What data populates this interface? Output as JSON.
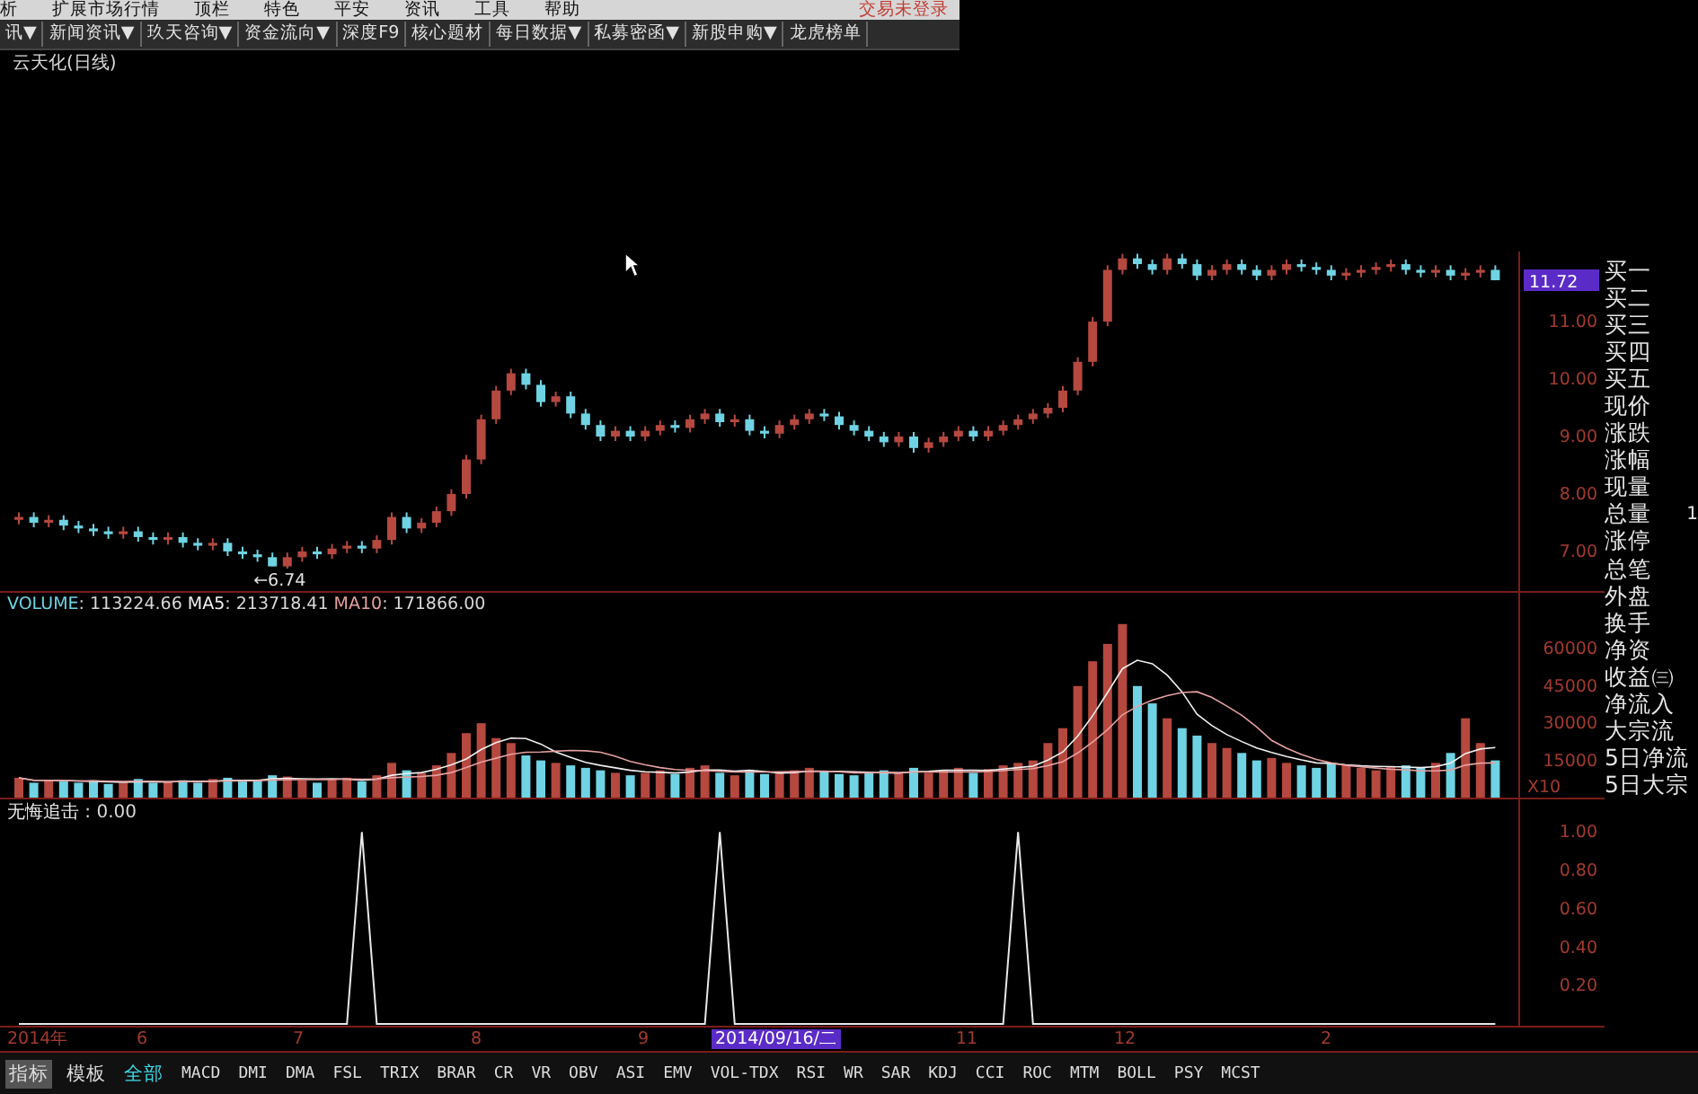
{
  "menu_bar": {
    "items": [
      "析",
      "扩展市场行情",
      "顶栏",
      "特色",
      "平安",
      "资讯",
      "工具",
      "帮助"
    ],
    "login_status": "交易未登录"
  },
  "toolbar": {
    "items": [
      "讯▼",
      "新闻资讯▼",
      "玖天咨询▼",
      "资金流向▼",
      "深度F9",
      "核心题材",
      "每日数据▼",
      "私募密函▼",
      "新股申购▼",
      "龙虎榜单"
    ]
  },
  "price_chart": {
    "title": "云天化(日线)",
    "low_marker": "←6.74",
    "current_price": "11.72",
    "chart_data": {
      "type": "candlestick",
      "ylim": [
        6.28,
        12.22
      ],
      "yticks": [
        {
          "value": 11,
          "label": "11.00"
        },
        {
          "value": 10,
          "label": "10.00"
        },
        {
          "value": 9,
          "label": "9.00"
        },
        {
          "value": 8,
          "label": "8.00"
        },
        {
          "value": 7,
          "label": "7.00"
        }
      ],
      "categories": [
        null,
        null,
        null,
        null,
        null,
        null,
        null,
        null,
        null,
        null,
        null,
        null,
        null,
        null,
        null,
        null,
        null,
        null,
        null,
        null,
        null,
        null,
        null,
        null,
        null,
        null,
        null,
        null,
        null,
        null,
        null,
        null,
        null,
        null,
        null,
        null,
        null,
        null,
        null,
        null,
        null,
        null,
        null,
        null,
        null,
        null,
        null,
        null,
        null,
        null,
        null,
        null,
        null,
        null,
        null,
        null,
        null,
        null,
        null,
        null,
        null,
        null,
        null,
        null,
        null,
        null,
        null,
        null,
        null,
        null,
        null,
        null,
        null,
        null,
        null,
        null,
        null,
        null,
        null,
        null,
        null,
        null,
        null,
        null,
        null,
        null,
        null,
        null,
        null,
        null,
        null,
        null,
        null,
        null,
        null,
        null,
        null,
        null,
        null,
        null
      ],
      "ohlc": [
        [
          7.55,
          7.68,
          7.47,
          7.6
        ],
        [
          7.6,
          7.68,
          7.42,
          7.5
        ],
        [
          7.5,
          7.63,
          7.42,
          7.55
        ],
        [
          7.55,
          7.63,
          7.37,
          7.45
        ],
        [
          7.45,
          7.53,
          7.32,
          7.4
        ],
        [
          7.4,
          7.48,
          7.27,
          7.35
        ],
        [
          7.35,
          7.43,
          7.22,
          7.3
        ],
        [
          7.3,
          7.43,
          7.22,
          7.35
        ],
        [
          7.35,
          7.43,
          7.17,
          7.25
        ],
        [
          7.25,
          7.33,
          7.12,
          7.2
        ],
        [
          7.2,
          7.33,
          7.12,
          7.25
        ],
        [
          7.25,
          7.33,
          7.07,
          7.15
        ],
        [
          7.15,
          7.23,
          7.02,
          7.1
        ],
        [
          7.1,
          7.23,
          7.02,
          7.15
        ],
        [
          7.15,
          7.23,
          6.92,
          7.0
        ],
        [
          7.0,
          7.08,
          6.87,
          6.95
        ],
        [
          6.95,
          7.03,
          6.82,
          6.9
        ],
        [
          6.9,
          6.98,
          6.74,
          6.74
        ],
        [
          6.74,
          6.98,
          6.7,
          6.9
        ],
        [
          6.9,
          7.08,
          6.82,
          7.0
        ],
        [
          7.0,
          7.08,
          6.87,
          6.95
        ],
        [
          6.95,
          7.13,
          6.87,
          7.05
        ],
        [
          7.05,
          7.18,
          6.97,
          7.1
        ],
        [
          7.1,
          7.18,
          6.97,
          7.05
        ],
        [
          7.05,
          7.28,
          6.97,
          7.2
        ],
        [
          7.2,
          7.68,
          7.12,
          7.6
        ],
        [
          7.6,
          7.68,
          7.32,
          7.4
        ],
        [
          7.4,
          7.58,
          7.32,
          7.5
        ],
        [
          7.5,
          7.78,
          7.42,
          7.7
        ],
        [
          7.7,
          8.08,
          7.62,
          8.0
        ],
        [
          8.0,
          8.68,
          7.92,
          8.6
        ],
        [
          8.6,
          9.38,
          8.52,
          9.3
        ],
        [
          9.3,
          9.88,
          9.22,
          9.8
        ],
        [
          9.8,
          10.18,
          9.72,
          10.1
        ],
        [
          10.1,
          10.18,
          9.82,
          9.9
        ],
        [
          9.9,
          9.98,
          9.52,
          9.6
        ],
        [
          9.6,
          9.78,
          9.52,
          9.7
        ],
        [
          9.7,
          9.78,
          9.32,
          9.4
        ],
        [
          9.4,
          9.48,
          9.12,
          9.2
        ],
        [
          9.2,
          9.28,
          8.92,
          9.0
        ],
        [
          9.0,
          9.18,
          8.92,
          9.1
        ],
        [
          9.1,
          9.18,
          8.92,
          9.0
        ],
        [
          9.0,
          9.18,
          8.92,
          9.1
        ],
        [
          9.1,
          9.28,
          9.02,
          9.2
        ],
        [
          9.2,
          9.28,
          9.07,
          9.15
        ],
        [
          9.15,
          9.38,
          9.07,
          9.3
        ],
        [
          9.3,
          9.48,
          9.22,
          9.4
        ],
        [
          9.4,
          9.48,
          9.17,
          9.25
        ],
        [
          9.25,
          9.38,
          9.17,
          9.3
        ],
        [
          9.3,
          9.38,
          9.02,
          9.1
        ],
        [
          9.1,
          9.18,
          8.97,
          9.05
        ],
        [
          9.05,
          9.28,
          8.97,
          9.2
        ],
        [
          9.2,
          9.38,
          9.12,
          9.3
        ],
        [
          9.3,
          9.48,
          9.22,
          9.4
        ],
        [
          9.4,
          9.48,
          9.27,
          9.35
        ],
        [
          9.35,
          9.43,
          9.12,
          9.2
        ],
        [
          9.2,
          9.28,
          9.02,
          9.1
        ],
        [
          9.1,
          9.18,
          8.92,
          9.0
        ],
        [
          9.0,
          9.08,
          8.82,
          8.9
        ],
        [
          8.9,
          9.08,
          8.82,
          9.0
        ],
        [
          9.0,
          9.08,
          8.72,
          8.8
        ],
        [
          8.8,
          8.98,
          8.72,
          8.9
        ],
        [
          8.9,
          9.08,
          8.82,
          9.0
        ],
        [
          9.0,
          9.18,
          8.92,
          9.1
        ],
        [
          9.1,
          9.18,
          8.92,
          9.0
        ],
        [
          9.0,
          9.18,
          8.92,
          9.1
        ],
        [
          9.1,
          9.28,
          9.02,
          9.2
        ],
        [
          9.2,
          9.38,
          9.12,
          9.3
        ],
        [
          9.3,
          9.48,
          9.22,
          9.4
        ],
        [
          9.4,
          9.58,
          9.32,
          9.5
        ],
        [
          9.5,
          9.88,
          9.42,
          9.8
        ],
        [
          9.8,
          10.38,
          9.72,
          10.3
        ],
        [
          10.3,
          11.08,
          10.22,
          11.0
        ],
        [
          11.0,
          11.98,
          10.92,
          11.9
        ],
        [
          11.9,
          12.18,
          11.82,
          12.1
        ],
        [
          12.1,
          12.18,
          11.92,
          12.0
        ],
        [
          12.0,
          12.08,
          11.82,
          11.9
        ],
        [
          11.9,
          12.18,
          11.82,
          12.1
        ],
        [
          12.1,
          12.18,
          11.92,
          12.0
        ],
        [
          12.0,
          12.08,
          11.72,
          11.8
        ],
        [
          11.8,
          11.98,
          11.72,
          11.9
        ],
        [
          11.9,
          12.08,
          11.82,
          12.0
        ],
        [
          12.0,
          12.08,
          11.82,
          11.9
        ],
        [
          11.9,
          11.98,
          11.72,
          11.8
        ],
        [
          11.8,
          11.98,
          11.72,
          11.9
        ],
        [
          11.9,
          12.08,
          11.82,
          12.0
        ],
        [
          12.0,
          12.08,
          11.87,
          11.95
        ],
        [
          11.95,
          12.03,
          11.82,
          11.9
        ],
        [
          11.9,
          11.98,
          11.72,
          11.8
        ],
        [
          11.8,
          11.93,
          11.72,
          11.85
        ],
        [
          11.85,
          11.98,
          11.77,
          11.9
        ],
        [
          11.9,
          12.03,
          11.82,
          11.95
        ],
        [
          11.95,
          12.08,
          11.87,
          12.0
        ],
        [
          12.0,
          12.08,
          11.82,
          11.9
        ],
        [
          11.9,
          11.98,
          11.77,
          11.85
        ],
        [
          11.85,
          11.98,
          11.77,
          11.9
        ],
        [
          11.9,
          11.98,
          11.72,
          11.8
        ],
        [
          11.8,
          11.93,
          11.72,
          11.85
        ],
        [
          11.85,
          11.98,
          11.77,
          11.9
        ],
        [
          11.9,
          11.98,
          11.72,
          11.72
        ]
      ]
    }
  },
  "volume_chart": {
    "separator": ": ",
    "readouts": [
      "113224.66",
      "213718.41",
      "171866.00"
    ],
    "unit_label": "X10",
    "chart_data": {
      "type": "bar",
      "categories": [
        null,
        null,
        null,
        null,
        null,
        null,
        null,
        null,
        null,
        null,
        null,
        null,
        null,
        null,
        null,
        null,
        null,
        null,
        null,
        null,
        null,
        null,
        null,
        null,
        null,
        null,
        null,
        null,
        null,
        null,
        null,
        null,
        null,
        null,
        null,
        null,
        null,
        null,
        null,
        null,
        null,
        null,
        null,
        null,
        null,
        null,
        null,
        null,
        null,
        null,
        null,
        null,
        null,
        null,
        null,
        null,
        null,
        null,
        null,
        null,
        null,
        null,
        null,
        null,
        null,
        null,
        null,
        null,
        null,
        null,
        null,
        null,
        null,
        null,
        null,
        null,
        null,
        null,
        null,
        null,
        null,
        null,
        null,
        null,
        null,
        null,
        null,
        null,
        null,
        null,
        null,
        null,
        null,
        null,
        null,
        null,
        null,
        null,
        null,
        null
      ],
      "ylim": [
        0,
        82600
      ],
      "yticks": [
        {
          "value": 15000,
          "label": "15000"
        },
        {
          "value": 30000,
          "label": "30000"
        },
        {
          "value": 45000,
          "label": "45000"
        },
        {
          "value": 60000,
          "label": "60000"
        }
      ],
      "series": [
        {
          "name": "VOLUME",
          "type": "bar",
          "colors": [
            "#b5483f",
            "#6fd3e3",
            "#b5483f",
            "#6fd3e3",
            "#6fd3e3",
            "#6fd3e3",
            "#6fd3e3",
            "#b5483f",
            "#6fd3e3",
            "#6fd3e3",
            "#b5483f",
            "#6fd3e3",
            "#6fd3e3",
            "#b5483f",
            "#6fd3e3",
            "#6fd3e3",
            "#6fd3e3",
            "#6fd3e3",
            "#b5483f",
            "#b5483f",
            "#6fd3e3",
            "#b5483f",
            "#b5483f",
            "#6fd3e3",
            "#b5483f",
            "#b5483f",
            "#6fd3e3",
            "#b5483f",
            "#b5483f",
            "#b5483f",
            "#b5483f",
            "#b5483f",
            "#b5483f",
            "#b5483f",
            "#6fd3e3",
            "#6fd3e3",
            "#b5483f",
            "#6fd3e3",
            "#6fd3e3",
            "#6fd3e3",
            "#b5483f",
            "#6fd3e3",
            "#b5483f",
            "#b5483f",
            "#6fd3e3",
            "#b5483f",
            "#b5483f",
            "#6fd3e3",
            "#b5483f",
            "#6fd3e3",
            "#6fd3e3",
            "#b5483f",
            "#b5483f",
            "#b5483f",
            "#6fd3e3",
            "#6fd3e3",
            "#6fd3e3",
            "#6fd3e3",
            "#6fd3e3",
            "#b5483f",
            "#6fd3e3",
            "#b5483f",
            "#b5483f",
            "#b5483f",
            "#6fd3e3",
            "#b5483f",
            "#b5483f",
            "#b5483f",
            "#b5483f",
            "#b5483f",
            "#b5483f",
            "#b5483f",
            "#b5483f",
            "#b5483f",
            "#b5483f",
            "#6fd3e3",
            "#6fd3e3",
            "#b5483f",
            "#6fd3e3",
            "#6fd3e3",
            "#b5483f",
            "#b5483f",
            "#6fd3e3",
            "#6fd3e3",
            "#b5483f",
            "#b5483f",
            "#6fd3e3",
            "#6fd3e3",
            "#6fd3e3",
            "#b5483f",
            "#b5483f",
            "#b5483f",
            "#b5483f",
            "#6fd3e3",
            "#6fd3e3",
            "#b5483f",
            "#6fd3e3",
            "#b5483f",
            "#b5483f",
            "#6fd3e3"
          ],
          "values": [
            8000,
            6000,
            7000,
            6500,
            6000,
            7000,
            5500,
            6000,
            7500,
            6000,
            6500,
            7000,
            6000,
            7500,
            8000,
            6500,
            7000,
            9000,
            8500,
            7000,
            6000,
            7500,
            8000,
            6500,
            9000,
            14000,
            11000,
            10000,
            13000,
            18000,
            26000,
            30000,
            24000,
            22000,
            17000,
            15000,
            14000,
            13000,
            12000,
            11000,
            10000,
            9000,
            10000,
            11000,
            9500,
            12000,
            13000,
            10000,
            9000,
            11000,
            9500,
            10000,
            11000,
            12000,
            10500,
            9500,
            9000,
            10000,
            11000,
            10000,
            12000,
            10000,
            11000,
            12000,
            10000,
            11500,
            13000,
            14000,
            15000,
            22000,
            28000,
            45000,
            55000,
            62000,
            70000,
            45000,
            38000,
            32000,
            28000,
            25000,
            22000,
            20000,
            18000,
            15000,
            16000,
            14000,
            13000,
            12000,
            14000,
            13000,
            12000,
            11000,
            12500,
            13000,
            12000,
            14000,
            18000,
            32000,
            22000,
            15000
          ]
        },
        {
          "name": "MA5",
          "type": "line",
          "color": "#f0f0f0",
          "values": [
            8000,
            7000,
            7000,
            6900,
            6700,
            6500,
            6400,
            6200,
            6400,
            6400,
            6300,
            6600,
            6600,
            6600,
            7000,
            7000,
            7000,
            7600,
            7800,
            7600,
            7500,
            7600,
            7400,
            7000,
            7400,
            9000,
            9700,
            10100,
            11400,
            13200,
            15600,
            19400,
            22200,
            24000,
            23800,
            21600,
            18400,
            16200,
            14200,
            13000,
            12000,
            11000,
            10400,
            10200,
            9900,
            10300,
            11100,
            11100,
            10700,
            11000,
            10500,
            9900,
            10100,
            10700,
            10600,
            10600,
            10400,
            10200,
            10000,
            9900,
            10400,
            10600,
            11000,
            11000,
            11000,
            10900,
            11500,
            12100,
            12700,
            15100,
            18400,
            24800,
            33000,
            42400,
            52000,
            55400,
            54000,
            49400,
            42600,
            33600,
            29000,
            25400,
            22600,
            20000,
            18200,
            16600,
            15200,
            14000,
            13800,
            13200,
            12800,
            12600,
            12500,
            12300,
            12100,
            12500,
            13900,
            17800,
            19600,
            20200
          ]
        },
        {
          "name": "MA10",
          "type": "line",
          "color": "#e6a0a0",
          "values": [
            8000,
            7000,
            7000,
            6900,
            6700,
            6800,
            6600,
            6500,
            6600,
            6600,
            6400,
            6500,
            6400,
            6500,
            6700,
            6700,
            6800,
            7100,
            7200,
            7300,
            7300,
            7300,
            7500,
            7400,
            7500,
            8000,
            8300,
            8500,
            9000,
            10100,
            12100,
            14300,
            15900,
            17500,
            18300,
            18400,
            18700,
            19000,
            18900,
            18300,
            16700,
            14600,
            13200,
            12100,
            11300,
            11000,
            10900,
            10600,
            10300,
            10300,
            10300,
            10400,
            10500,
            10600,
            10700,
            10400,
            10000,
            10000,
            10200,
            10100,
            10300,
            10300,
            10300,
            10300,
            10300,
            10500,
            10900,
            11300,
            11700,
            12900,
            14500,
            18000,
            22400,
            27400,
            33400,
            36800,
            39300,
            41100,
            42400,
            42700,
            40400,
            36900,
            33200,
            28500,
            23100,
            19900,
            17400,
            15400,
            14000,
            13000,
            12400,
            11900,
            11400,
            11200,
            10800,
            10800,
            11100,
            13100,
            13900,
            14000
          ]
        }
      ]
    }
  },
  "indicator_chart": {
    "separator": " : ",
    "readouts": [
      "0.00"
    ],
    "chart_data": {
      "type": "line",
      "ylim": [
        0,
        1.17
      ],
      "categories": [
        null,
        null,
        null,
        null,
        null,
        null,
        null,
        null,
        null,
        null,
        null,
        null,
        null,
        null,
        null,
        null,
        null,
        null,
        null,
        null,
        null,
        null,
        null,
        null,
        null,
        null,
        null,
        null,
        null,
        null,
        null,
        null,
        null,
        null,
        null,
        null,
        null,
        null,
        null,
        null,
        null,
        null,
        null,
        null,
        null,
        null,
        null,
        null,
        null,
        null,
        null,
        null,
        null,
        null,
        null,
        null,
        null,
        null,
        null,
        null,
        null,
        null,
        null,
        null,
        null,
        null,
        null,
        null,
        null,
        null,
        null,
        null,
        null,
        null,
        null,
        null,
        null,
        null,
        null,
        null,
        null,
        null,
        null,
        null,
        null,
        null,
        null,
        null,
        null,
        null,
        null,
        null,
        null,
        null,
        null,
        null,
        null,
        null,
        null,
        null
      ],
      "yticks": [
        {
          "value": 1,
          "label": "1.00"
        },
        {
          "value": 0.8,
          "label": "0.80"
        },
        {
          "value": 0.6,
          "label": "0.60"
        },
        {
          "value": 0.4,
          "label": "0.40"
        },
        {
          "value": 0.2,
          "label": "0.20"
        }
      ],
      "series": [
        {
          "name": "无悔追击",
          "color": "#e8e8e8",
          "values": [
            0,
            0,
            0,
            0,
            0,
            0,
            0,
            0,
            0,
            0,
            0,
            0,
            0,
            0,
            0,
            0,
            0,
            0,
            0,
            0,
            0,
            0,
            0,
            1,
            0,
            0,
            0,
            0,
            0,
            0,
            0,
            0,
            0,
            0,
            0,
            0,
            0,
            0,
            0,
            0,
            0,
            0,
            0,
            0,
            0,
            0,
            0,
            1,
            0,
            0,
            0,
            0,
            0,
            0,
            0,
            0,
            0,
            0,
            0,
            0,
            0,
            0,
            0,
            0,
            0,
            0,
            0,
            1,
            0,
            0,
            0,
            0,
            0,
            0,
            0,
            0,
            0,
            0,
            0,
            0,
            0,
            0,
            0,
            0,
            0,
            0,
            0,
            0,
            0,
            0,
            0,
            0,
            0,
            0,
            0,
            0,
            0,
            0,
            0,
            0
          ]
        }
      ]
    }
  },
  "quote_panel": {
    "items": [
      {
        "label": "买一"
      },
      {
        "label": "买二"
      },
      {
        "label": "买三"
      },
      {
        "label": "买四"
      },
      {
        "label": "买五"
      },
      {
        "label": "现价"
      },
      {
        "label": "涨跌"
      },
      {
        "label": "涨幅"
      },
      {
        "label": "现量"
      },
      {
        "label": "总量",
        "value": "1"
      },
      {
        "label": "涨停"
      },
      {
        "label": "总笔"
      },
      {
        "label": "外盘"
      },
      {
        "label": "换手"
      },
      {
        "label": "净资"
      },
      {
        "label": "收益㈢"
      },
      {
        "label": "净流入"
      },
      {
        "label": "大宗流"
      },
      {
        "label": "5日净流"
      },
      {
        "label": "5日大宗"
      }
    ]
  },
  "date_axis": {
    "ticks": [
      {
        "kind": "tick",
        "label": "2014年"
      },
      {
        "kind": "tick",
        "label": "6"
      },
      {
        "kind": "tick",
        "label": "7"
      },
      {
        "kind": "tick",
        "label": "8"
      },
      {
        "kind": "tick",
        "label": "9"
      },
      {
        "kind": "cursor",
        "label": "2014/09/16/二"
      },
      {
        "kind": "tick",
        "label": "11"
      },
      {
        "kind": "tick",
        "label": "12"
      },
      {
        "kind": "tick",
        "label": "2"
      }
    ]
  },
  "bottom_bar": {
    "modes": [
      {
        "label": "指标",
        "selected": true
      },
      {
        "label": "模板",
        "selected": false
      }
    ],
    "tabs": [
      {
        "label": "全部",
        "selected": true
      },
      {
        "label": "MACD",
        "selected": false
      },
      {
        "label": "DMI",
        "selected": false
      },
      {
        "label": "DMA",
        "selected": false
      },
      {
        "label": "FSL",
        "selected": false
      },
      {
        "label": "TRIX",
        "selected": false
      },
      {
        "label": "BRAR",
        "selected": false
      },
      {
        "label": "CR",
        "selected": false
      },
      {
        "label": "VR",
        "selected": false
      },
      {
        "label": "OBV",
        "selected": false
      },
      {
        "label": "ASI",
        "selected": false
      },
      {
        "label": "EMV",
        "selected": false
      },
      {
        "label": "VOL-TDX",
        "selected": false
      },
      {
        "label": "RSI",
        "selected": false
      },
      {
        "label": "WR",
        "selected": false
      },
      {
        "label": "SAR",
        "selected": false
      },
      {
        "label": "KDJ",
        "selected": false
      },
      {
        "label": "CCI",
        "selected": false
      },
      {
        "label": "ROC",
        "selected": false
      },
      {
        "label": "MTM",
        "selected": false
      },
      {
        "label": "BOLL",
        "selected": false
      },
      {
        "label": "PSY",
        "selected": false
      },
      {
        "label": "MCST",
        "selected": false
      }
    ]
  }
}
